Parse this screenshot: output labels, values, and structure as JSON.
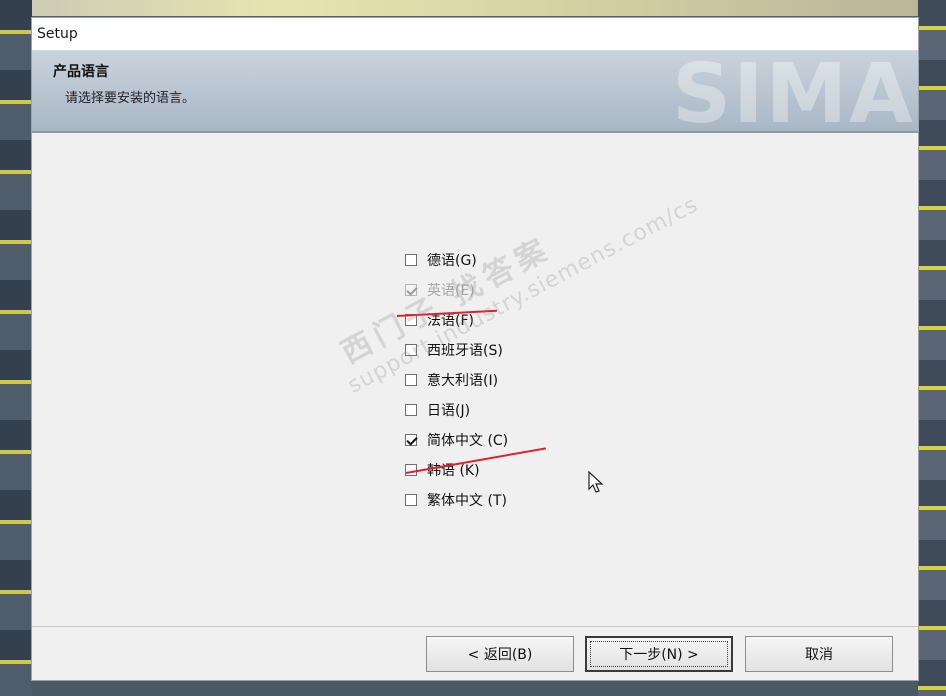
{
  "window": {
    "title": "Setup"
  },
  "header": {
    "title": "产品语言",
    "subtitle": "请选择要安装的语言。",
    "watermark": "SIMA"
  },
  "languages": [
    {
      "label": "德语(G)",
      "checked": false,
      "disabled": false
    },
    {
      "label": "英语(E)",
      "checked": true,
      "disabled": true
    },
    {
      "label": "法语(F)",
      "checked": false,
      "disabled": false
    },
    {
      "label": "西班牙语(S)",
      "checked": false,
      "disabled": false
    },
    {
      "label": "意大利语(I)",
      "checked": false,
      "disabled": false
    },
    {
      "label": "日语(J)",
      "checked": false,
      "disabled": false
    },
    {
      "label": "简体中文 (C)",
      "checked": true,
      "disabled": false
    },
    {
      "label": "韩语 (K)",
      "checked": false,
      "disabled": false
    },
    {
      "label": "繁体中文 (T)",
      "checked": false,
      "disabled": false
    }
  ],
  "watermark_overlay": {
    "line1": "西门子  找答案",
    "line2": "support.industry.siemens.com/cs"
  },
  "buttons": {
    "back": "< 返回(B)",
    "next": "下一步(N) >",
    "cancel": "取消"
  },
  "colors": {
    "annotation": "#e0212b",
    "header_bg": "#b4c1cd"
  }
}
